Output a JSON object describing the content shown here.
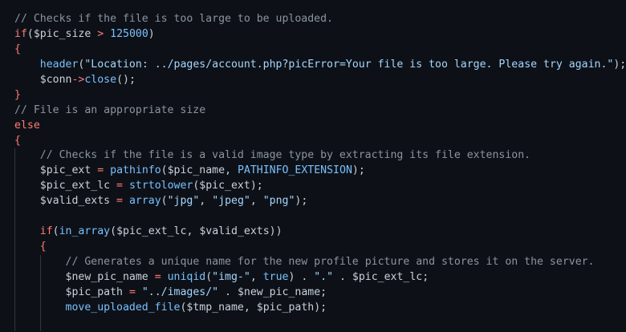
{
  "editor": {
    "language": "PHP",
    "colors": {
      "background": "#0d1117",
      "comment": "#8b949e",
      "keyword": "#ff7b72",
      "function": "#79c0ff",
      "string": "#a5d6ff",
      "variable": "#c9d1d9"
    },
    "lines": [
      [
        {
          "t": "// Checks if the file is too large to be uploaded.",
          "c": "comment"
        }
      ],
      [
        {
          "t": "if",
          "c": "keyword"
        },
        {
          "t": "(",
          "c": "punct"
        },
        {
          "t": "$pic_size",
          "c": "var"
        },
        {
          "t": " > ",
          "c": "op"
        },
        {
          "t": "125000",
          "c": "num"
        },
        {
          "t": ")",
          "c": "punct"
        }
      ],
      [
        {
          "t": "{",
          "c": "brace"
        }
      ],
      [
        {
          "t": "    ",
          "c": "punct"
        },
        {
          "t": "header",
          "c": "func"
        },
        {
          "t": "(",
          "c": "punct"
        },
        {
          "t": "\"Location: ../pages/account.php?picError=Your file is too large. Please try again.\"",
          "c": "str"
        },
        {
          "t": ");",
          "c": "punct"
        }
      ],
      [
        {
          "t": "    ",
          "c": "punct"
        },
        {
          "t": "$conn",
          "c": "var"
        },
        {
          "t": "->",
          "c": "op"
        },
        {
          "t": "close",
          "c": "func"
        },
        {
          "t": "();",
          "c": "punct"
        }
      ],
      [
        {
          "t": "}",
          "c": "brace"
        }
      ],
      [
        {
          "t": "// File is an appropriate size",
          "c": "comment"
        }
      ],
      [
        {
          "t": "else",
          "c": "keyword"
        }
      ],
      [
        {
          "t": "{",
          "c": "brace"
        }
      ],
      [
        {
          "t": "    ",
          "c": "punct"
        },
        {
          "t": "// Checks if the file is a valid image type by extracting its file extension.",
          "c": "comment"
        }
      ],
      [
        {
          "t": "    ",
          "c": "punct"
        },
        {
          "t": "$pic_ext",
          "c": "var"
        },
        {
          "t": " = ",
          "c": "op"
        },
        {
          "t": "pathinfo",
          "c": "func"
        },
        {
          "t": "(",
          "c": "punct"
        },
        {
          "t": "$pic_name",
          "c": "var"
        },
        {
          "t": ", ",
          "c": "punct"
        },
        {
          "t": "PATHINFO_EXTENSION",
          "c": "const"
        },
        {
          "t": ");",
          "c": "punct"
        }
      ],
      [
        {
          "t": "    ",
          "c": "punct"
        },
        {
          "t": "$pic_ext_lc",
          "c": "var"
        },
        {
          "t": " = ",
          "c": "op"
        },
        {
          "t": "strtolower",
          "c": "func"
        },
        {
          "t": "(",
          "c": "punct"
        },
        {
          "t": "$pic_ext",
          "c": "var"
        },
        {
          "t": ");",
          "c": "punct"
        }
      ],
      [
        {
          "t": "    ",
          "c": "punct"
        },
        {
          "t": "$valid_exts",
          "c": "var"
        },
        {
          "t": " = ",
          "c": "op"
        },
        {
          "t": "array",
          "c": "func"
        },
        {
          "t": "(",
          "c": "punct"
        },
        {
          "t": "\"jpg\"",
          "c": "str"
        },
        {
          "t": ", ",
          "c": "punct"
        },
        {
          "t": "\"jpeg\"",
          "c": "str"
        },
        {
          "t": ", ",
          "c": "punct"
        },
        {
          "t": "\"png\"",
          "c": "str"
        },
        {
          "t": ");",
          "c": "punct"
        }
      ],
      [],
      [
        {
          "t": "    ",
          "c": "punct"
        },
        {
          "t": "if",
          "c": "keyword"
        },
        {
          "t": "(",
          "c": "punct"
        },
        {
          "t": "in_array",
          "c": "func"
        },
        {
          "t": "(",
          "c": "punct"
        },
        {
          "t": "$pic_ext_lc",
          "c": "var"
        },
        {
          "t": ", ",
          "c": "punct"
        },
        {
          "t": "$valid_exts",
          "c": "var"
        },
        {
          "t": "))",
          "c": "punct"
        }
      ],
      [
        {
          "t": "    ",
          "c": "punct"
        },
        {
          "t": "{",
          "c": "brace"
        }
      ],
      [
        {
          "t": "        ",
          "c": "punct"
        },
        {
          "t": "// Generates a unique name for the new profile picture and stores it on the server.",
          "c": "comment"
        }
      ],
      [
        {
          "t": "        ",
          "c": "punct"
        },
        {
          "t": "$new_pic_name",
          "c": "var"
        },
        {
          "t": " = ",
          "c": "op"
        },
        {
          "t": "uniqid",
          "c": "func"
        },
        {
          "t": "(",
          "c": "punct"
        },
        {
          "t": "\"img-\"",
          "c": "str"
        },
        {
          "t": ", ",
          "c": "punct"
        },
        {
          "t": "true",
          "c": "const"
        },
        {
          "t": ") . ",
          "c": "punct"
        },
        {
          "t": "\".\"",
          "c": "str"
        },
        {
          "t": " . ",
          "c": "punct"
        },
        {
          "t": "$pic_ext_lc",
          "c": "var"
        },
        {
          "t": ";",
          "c": "punct"
        }
      ],
      [
        {
          "t": "        ",
          "c": "punct"
        },
        {
          "t": "$pic_path",
          "c": "var"
        },
        {
          "t": " = ",
          "c": "op"
        },
        {
          "t": "\"../images/\"",
          "c": "str"
        },
        {
          "t": " . ",
          "c": "punct"
        },
        {
          "t": "$new_pic_name",
          "c": "var"
        },
        {
          "t": ";",
          "c": "punct"
        }
      ],
      [
        {
          "t": "        ",
          "c": "punct"
        },
        {
          "t": "move_uploaded_file",
          "c": "func"
        },
        {
          "t": "(",
          "c": "punct"
        },
        {
          "t": "$tmp_name",
          "c": "var"
        },
        {
          "t": ", ",
          "c": "punct"
        },
        {
          "t": "$pic_path",
          "c": "var"
        },
        {
          "t": ");",
          "c": "punct"
        }
      ],
      []
    ]
  }
}
